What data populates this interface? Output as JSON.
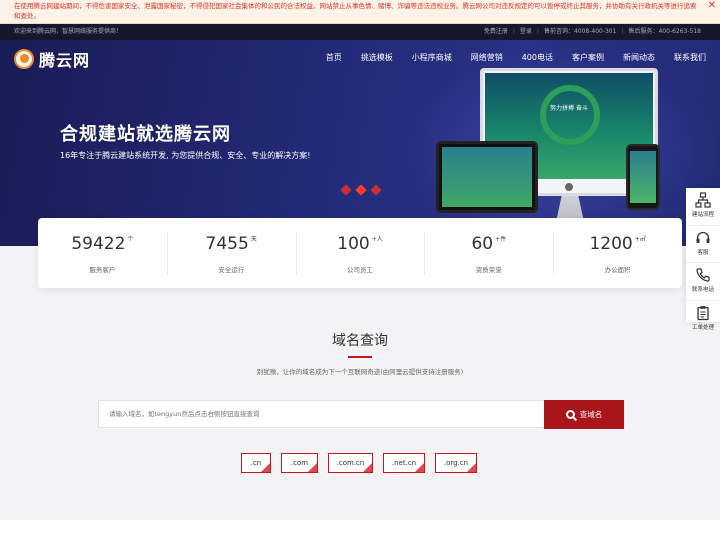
{
  "warning": {
    "text": "在使用腾云网建站期间，不得危害国家安全、泄露国家秘密，不得侵犯国家社会集体的和公民的合法权益。网站禁止从事色情、赌博、诈骗等违法违规业务。腾云网公司对违反规定的可以暂停或终止其服务，并协助有关行政机关等进行追索和查处。",
    "close": "✕"
  },
  "topbar": {
    "welcome": "欢迎来到腾云网，智慧网络服务提供商！",
    "register": "免费注册",
    "login": "登录",
    "presales": "售前咨询：4008-400-301",
    "aftersales": "售后服务：400-6263-518"
  },
  "header": {
    "logo_text": "腾云网",
    "nav": [
      "首页",
      "挑选模板",
      "小程序商城",
      "网络营销",
      "400电话",
      "客户案例",
      "新闻动态",
      "联系我们"
    ]
  },
  "hero": {
    "title": "合规建站就选腾云网",
    "subtitle": "16年专注于腾云建站系统开发, 为您提供合规、安全、专业的解决方案!",
    "monitor_slogan": "努力拼搏 奋斗",
    "slide_count": 3,
    "active_slide": 2
  },
  "stats": [
    {
      "value": "59422",
      "unit": "个",
      "label": "服务客户"
    },
    {
      "value": "7455",
      "unit": "天",
      "label": "安全运行"
    },
    {
      "value": "100",
      "unit": "+人",
      "label": "公司员工"
    },
    {
      "value": "60",
      "unit": "+件",
      "label": "资质荣誉"
    },
    {
      "value": "1200",
      "unit": "+㎡",
      "label": "办公面积"
    }
  ],
  "domain": {
    "title": "域名查询",
    "description": "别犹豫，让你的域名成为下一个互联网奇迹(由阿里云提供支持注册服务)",
    "placeholder": "请输入域名，如tengyun然后点击右侧按钮直接查询",
    "button": "查域名",
    "tlds": [
      ".cn",
      ".com",
      ".com.cn",
      ".net.cn",
      ".org.cn"
    ]
  },
  "float_bar": [
    {
      "label": "建站流程",
      "icon": "sitemap-icon"
    },
    {
      "label": "客服",
      "icon": "headset-icon"
    },
    {
      "label": "联系电话",
      "icon": "phone-icon"
    },
    {
      "label": "工单处理",
      "icon": "clipboard-icon"
    }
  ]
}
